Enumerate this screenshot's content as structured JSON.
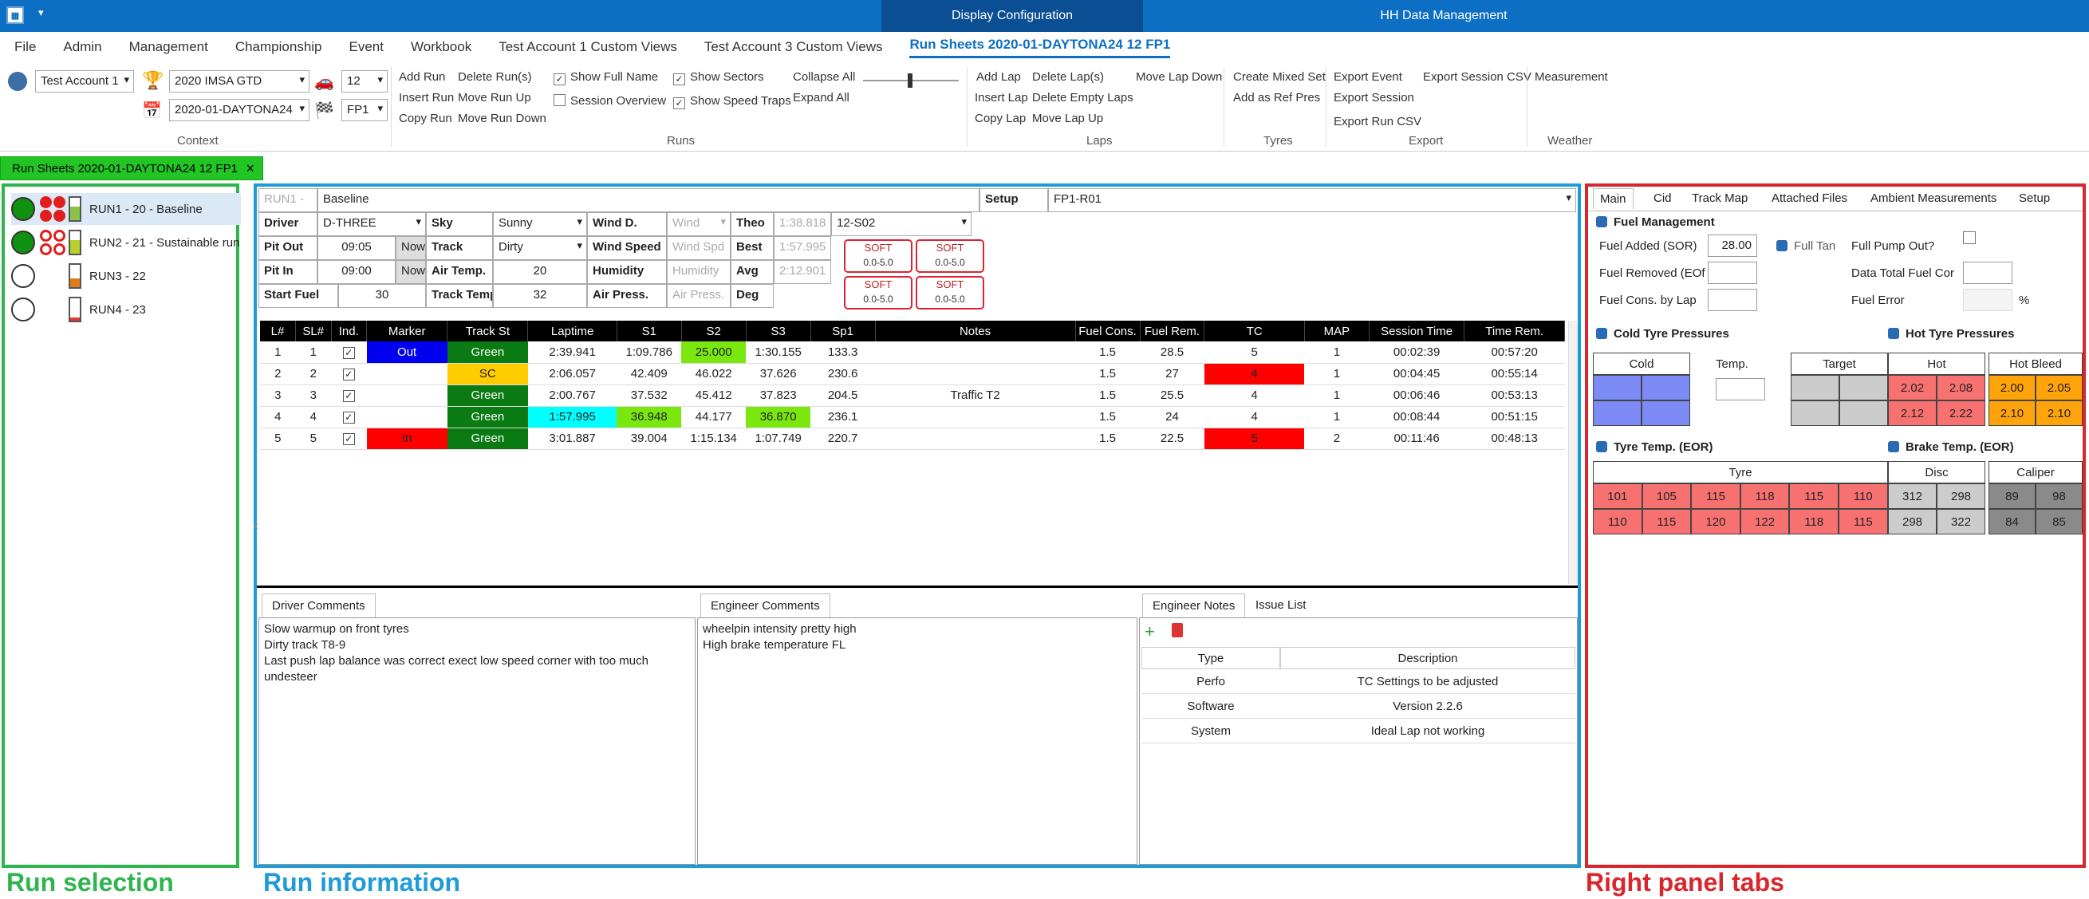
{
  "title": {
    "display": "Display Configuration",
    "hh": "HH Data Management"
  },
  "menu": [
    "File",
    "Admin",
    "Management",
    "Championship",
    "Event",
    "Workbook",
    "Test Account 1 Custom Views",
    "Test Account 3 Custom Views",
    "Run Sheets 2020-01-DAYTONA24 12 FP1"
  ],
  "context": {
    "account": "Test Account 1",
    "championship": "2020 IMSA GTD",
    "car": "12",
    "event": "2020-01-DAYTONA24",
    "session": "FP1",
    "label": "Context"
  },
  "runs": {
    "items": [
      "Add Run",
      "Delete Run(s)",
      "Insert Run",
      "Move Run Up",
      "Copy Run",
      "Move Run Down"
    ],
    "checks": [
      {
        "label": "Show Full Name",
        "on": true
      },
      {
        "label": "Show Sectors",
        "on": true
      },
      {
        "label": "Session Overview",
        "on": false
      },
      {
        "label": "Show Speed Traps",
        "on": true
      }
    ],
    "collapse": "Collapse All",
    "expand": "Expand All",
    "label": "Runs"
  },
  "laps": {
    "items": [
      "Add Lap",
      "Delete Lap(s)",
      "Move Lap Down",
      "Insert Lap",
      "Delete Empty Laps",
      "Copy Lap",
      "Move Lap Up"
    ],
    "label": "Laps"
  },
  "tyres": {
    "items": [
      "Create Mixed Set",
      "Add as Ref Pres"
    ],
    "label": "Tyres"
  },
  "export": {
    "items": [
      "Export Event",
      "Export Session CSV",
      "Export Session",
      "Export Run CSV"
    ],
    "label": "Export"
  },
  "weather": {
    "items": [
      "Measurement"
    ],
    "label": "Weather"
  },
  "sheet_tab": "Run Sheets 2020-01-DAYTONA24 12 FP1",
  "run_list": [
    {
      "label": "RUN1 - 20 - Baseline",
      "state": "done",
      "fuel": 0.6,
      "fuel_color": "#8bc34a",
      "selected": true
    },
    {
      "label": "RUN2 - 21 - Sustainable run",
      "state": "done",
      "fuel": 0.6,
      "fuel_color": "#b5d12a",
      "selected": false
    },
    {
      "label": "RUN3 - 22",
      "state": "empty",
      "fuel": 0.4,
      "fuel_color": "#e07b1a",
      "selected": false
    },
    {
      "label": "RUN4 - 23",
      "state": "empty",
      "fuel": 0.15,
      "fuel_color": "#e53935",
      "selected": false
    }
  ],
  "labels": {
    "run_selection": "Run selection",
    "run_information": "Run information",
    "right_panel_tabs": "Right panel tabs"
  },
  "info": {
    "run_id": "RUN1 -",
    "run_name": "Baseline",
    "setup_label": "Setup",
    "setup": "FP1-R01",
    "driver_l": "Driver",
    "driver": "D-THREE",
    "sky_l": "Sky",
    "sky": "Sunny",
    "windd_l": "Wind D.",
    "windd": "Wind",
    "theo_l": "Theo",
    "theo": "1:38.818",
    "theo_sel": "12-S02",
    "pitout_l": "Pit Out",
    "pitout": "09:05",
    "now": "Now",
    "track_l": "Track",
    "track": "Dirty",
    "winds_l": "Wind Speed",
    "winds": "Wind Spd",
    "best_l": "Best",
    "best": "1:57.995",
    "pitin_l": "Pit In",
    "pitin": "09:00",
    "airt_l": "Air Temp.",
    "airt": "20",
    "hum_l": "Humidity",
    "hum": "Humidity",
    "avg_l": "Avg",
    "avg": "2:12.901",
    "sfuel_l": "Start Fuel",
    "sfuel": "30",
    "trackt_l": "Track Temp",
    "trackt": "32",
    "airp_l": "Air Press.",
    "airp": "Air Press.",
    "deg_l": "Deg",
    "tyre_name": "SOFT",
    "tyre_range": "0.0-5.0"
  },
  "lap_headers": [
    "L#",
    "SL#",
    "Ind.",
    "Marker",
    "Track St",
    "Laptime",
    "S1",
    "S2",
    "S3",
    "Sp1",
    "Notes",
    "Fuel Cons.",
    "Fuel Rem.",
    "TC",
    "MAP",
    "Session Time",
    "Time Rem."
  ],
  "laps_data": [
    [
      "1",
      "1",
      "✓",
      "Out",
      "Green",
      "2:39.941",
      "1:09.786",
      "25.000",
      "1:30.155",
      "133.3",
      "",
      "1.5",
      "28.5",
      "5",
      "1",
      "00:02:39",
      "00:57:20"
    ],
    [
      "2",
      "2",
      "✓",
      "",
      "SC",
      "2:06.057",
      "42.409",
      "46.022",
      "37.626",
      "230.6",
      "",
      "1.5",
      "27",
      "4",
      "1",
      "00:04:45",
      "00:55:14"
    ],
    [
      "3",
      "3",
      "✓",
      "",
      "Green",
      "2:00.767",
      "37.532",
      "45.412",
      "37.823",
      "204.5",
      "Traffic T2",
      "1.5",
      "25.5",
      "4",
      "1",
      "00:06:46",
      "00:53:13"
    ],
    [
      "4",
      "4",
      "✓",
      "",
      "Green",
      "1:57.995",
      "36.948",
      "44.177",
      "36.870",
      "236.1",
      "",
      "1.5",
      "24",
      "4",
      "1",
      "00:08:44",
      "00:51:15"
    ],
    [
      "5",
      "5",
      "✓",
      "In",
      "Green",
      "3:01.887",
      "39.004",
      "1:15.134",
      "1:07.749",
      "220.7",
      "",
      "1.5",
      "22.5",
      "5",
      "2",
      "00:11:46",
      "00:48:13"
    ]
  ],
  "comments": {
    "driver_tab": "Driver Comments",
    "driver": [
      "Slow warmup on front tyres",
      "Dirty track T8-9",
      "Last push lap balance was correct exect low speed corner with too much",
      "undesteer"
    ],
    "engineer_tab": "Engineer Comments",
    "engineer": [
      "wheelpin intensity pretty high",
      "High brake temperature FL"
    ]
  },
  "notes": {
    "tab1": "Engineer Notes",
    "tab2": "Issue List",
    "head_type": "Type",
    "head_desc": "Description",
    "rows": [
      [
        "Perfo",
        "TC Settings to be adjusted"
      ],
      [
        "Software",
        "Version 2.2.6"
      ],
      [
        "System",
        "Ideal Lap not working"
      ]
    ]
  },
  "right": {
    "tabs": [
      "Main",
      "Cid",
      "Track Map",
      "Attached Files",
      "Ambient Measurements",
      "Setup"
    ],
    "fuel_mgmt": "Fuel Management",
    "fuel_added_l": "Fuel Added (SOR)",
    "fuel_added": "28.00",
    "full_tank": "Full Tan",
    "full_pump": "Full Pump Out?",
    "fuel_removed_l": "Fuel Removed (EOf",
    "data_total": "Data Total Fuel Cor",
    "fuel_cons_l": "Fuel Cons. by Lap",
    "fuel_error": "Fuel Error",
    "pct": "%",
    "cold_title": "Cold Tyre Pressures",
    "hot_title": "Hot Tyre Pressures",
    "cold": "Cold",
    "temp": "Temp.",
    "target": "Target",
    "hot": "Hot",
    "hot_bleed": "Hot Bleed",
    "hot_vals": [
      "2.02",
      "2.08",
      "2.12",
      "2.22"
    ],
    "bleed_vals": [
      "2.00",
      "2.05",
      "2.10",
      "2.10"
    ],
    "tyre_temp_title": "Tyre Temp. (EOR)",
    "brake_title": "Brake Temp. (EOR)",
    "tyre": "Tyre",
    "disc": "Disc",
    "caliper": "Caliper",
    "tyre_vals": [
      [
        "101",
        "105",
        "115",
        "118",
        "115",
        "110"
      ],
      [
        "110",
        "115",
        "120",
        "122",
        "118",
        "115"
      ]
    ],
    "disc_vals": [
      [
        "312",
        "298"
      ],
      [
        "298",
        "322"
      ]
    ],
    "cal_vals": [
      [
        "89",
        "98"
      ],
      [
        "84",
        "85"
      ]
    ]
  }
}
